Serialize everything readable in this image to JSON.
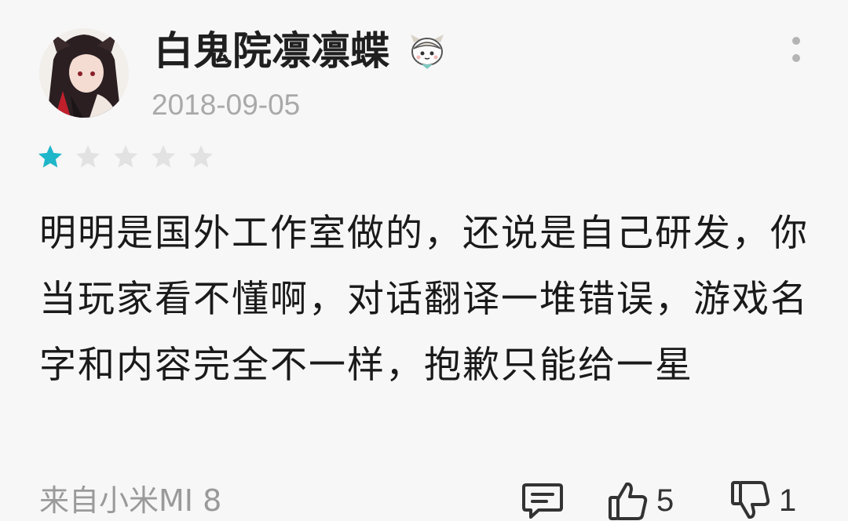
{
  "review": {
    "username": "白鬼院凛凛蝶",
    "date": "2018-09-05",
    "rating": 1,
    "max_rating": 5,
    "text": "明明是国外工作室做的，还说是自己研发，你当玩家看不懂啊，对话翻译一堆错误，游戏名字和内容完全不一样，抱歉只能给一星",
    "device": "来自小米MI 8",
    "likes": "5",
    "dislikes": "1"
  },
  "icons": {
    "avatar": "avatar-image",
    "badge": "badge-icon",
    "more": "more-vertical-icon",
    "comment": "comment-icon",
    "like": "thumbs-up-icon",
    "dislike": "thumbs-down-icon"
  },
  "colors": {
    "star_active": "#1fb6c9",
    "star_inactive": "#e2e2e2",
    "background": "#f7f7f7"
  }
}
